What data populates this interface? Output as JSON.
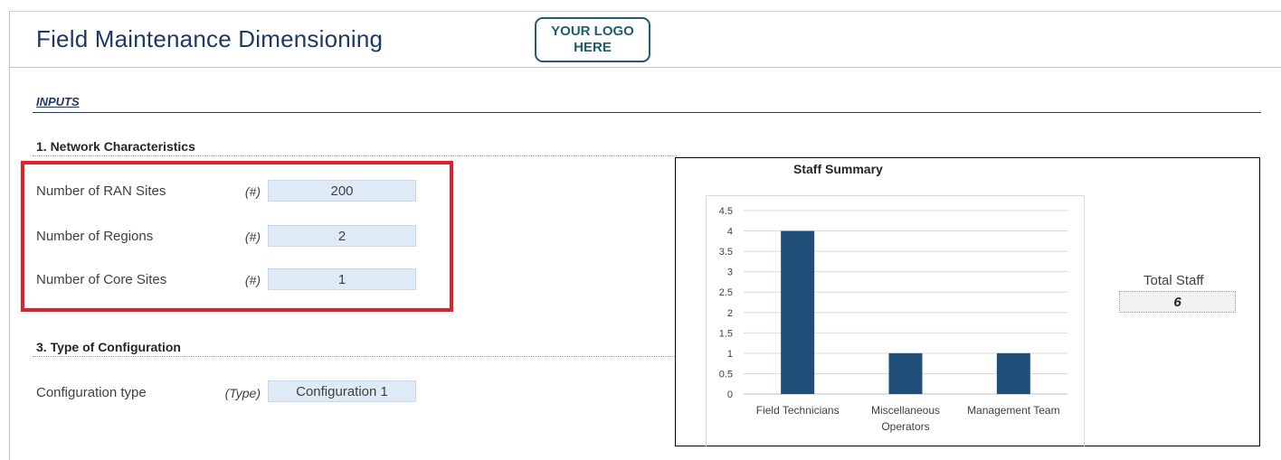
{
  "header": {
    "title": "Field Maintenance Dimensioning",
    "logo_line1": "YOUR LOGO",
    "logo_line2": "HERE"
  },
  "inputs": {
    "label": "INPUTS",
    "network": {
      "title": "1. Network Characteristics",
      "rows": [
        {
          "label": "Number of RAN Sites",
          "unit": "(#)",
          "value": "200"
        },
        {
          "label": "Number of Regions",
          "unit": "(#)",
          "value": "2"
        },
        {
          "label": "Number of Core Sites",
          "unit": "(#)",
          "value": "1"
        }
      ]
    },
    "configuration": {
      "title": "3. Type of Configuration",
      "rows": [
        {
          "label": "Configuration type",
          "unit": "(Type)",
          "value": "Configuration 1"
        }
      ]
    }
  },
  "summary": {
    "total_label": "Total Staff",
    "total_value": "6"
  },
  "colors": {
    "title": "#1f3864",
    "bar": "#1f4e79",
    "highlight": "#e0202a",
    "input_fill": "#deebf7"
  },
  "chart_data": {
    "type": "bar",
    "title": "Staff Summary",
    "categories": [
      "Field Technicians",
      "Miscellaneous Operators",
      "Management Team"
    ],
    "category_lines": [
      [
        "Field Technicians"
      ],
      [
        "Miscellaneous",
        "Operators"
      ],
      [
        "Management Team"
      ]
    ],
    "values": [
      4,
      1,
      1
    ],
    "ylim": [
      0,
      4.5
    ],
    "yticks": [
      "0",
      "0.5",
      "1",
      "1.5",
      "2",
      "2.5",
      "3",
      "3.5",
      "4",
      "4.5"
    ],
    "xlabel": "",
    "ylabel": "",
    "grid": true,
    "legend": "none"
  }
}
